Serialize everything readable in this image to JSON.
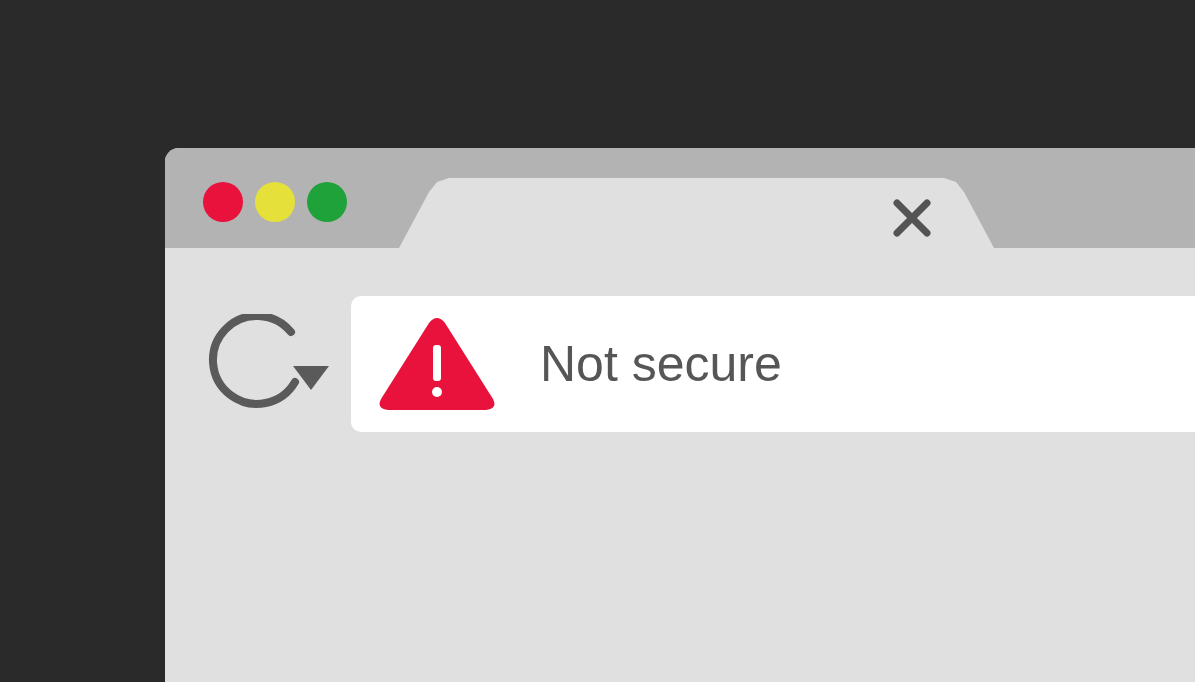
{
  "window": {
    "controls": [
      {
        "color": "#e8123c"
      },
      {
        "color": "#e6e13a"
      },
      {
        "color": "#20a23a"
      }
    ]
  },
  "tabs": [
    {
      "selected": true
    }
  ],
  "address_bar": {
    "kind": "warning",
    "status": "Not secure"
  }
}
